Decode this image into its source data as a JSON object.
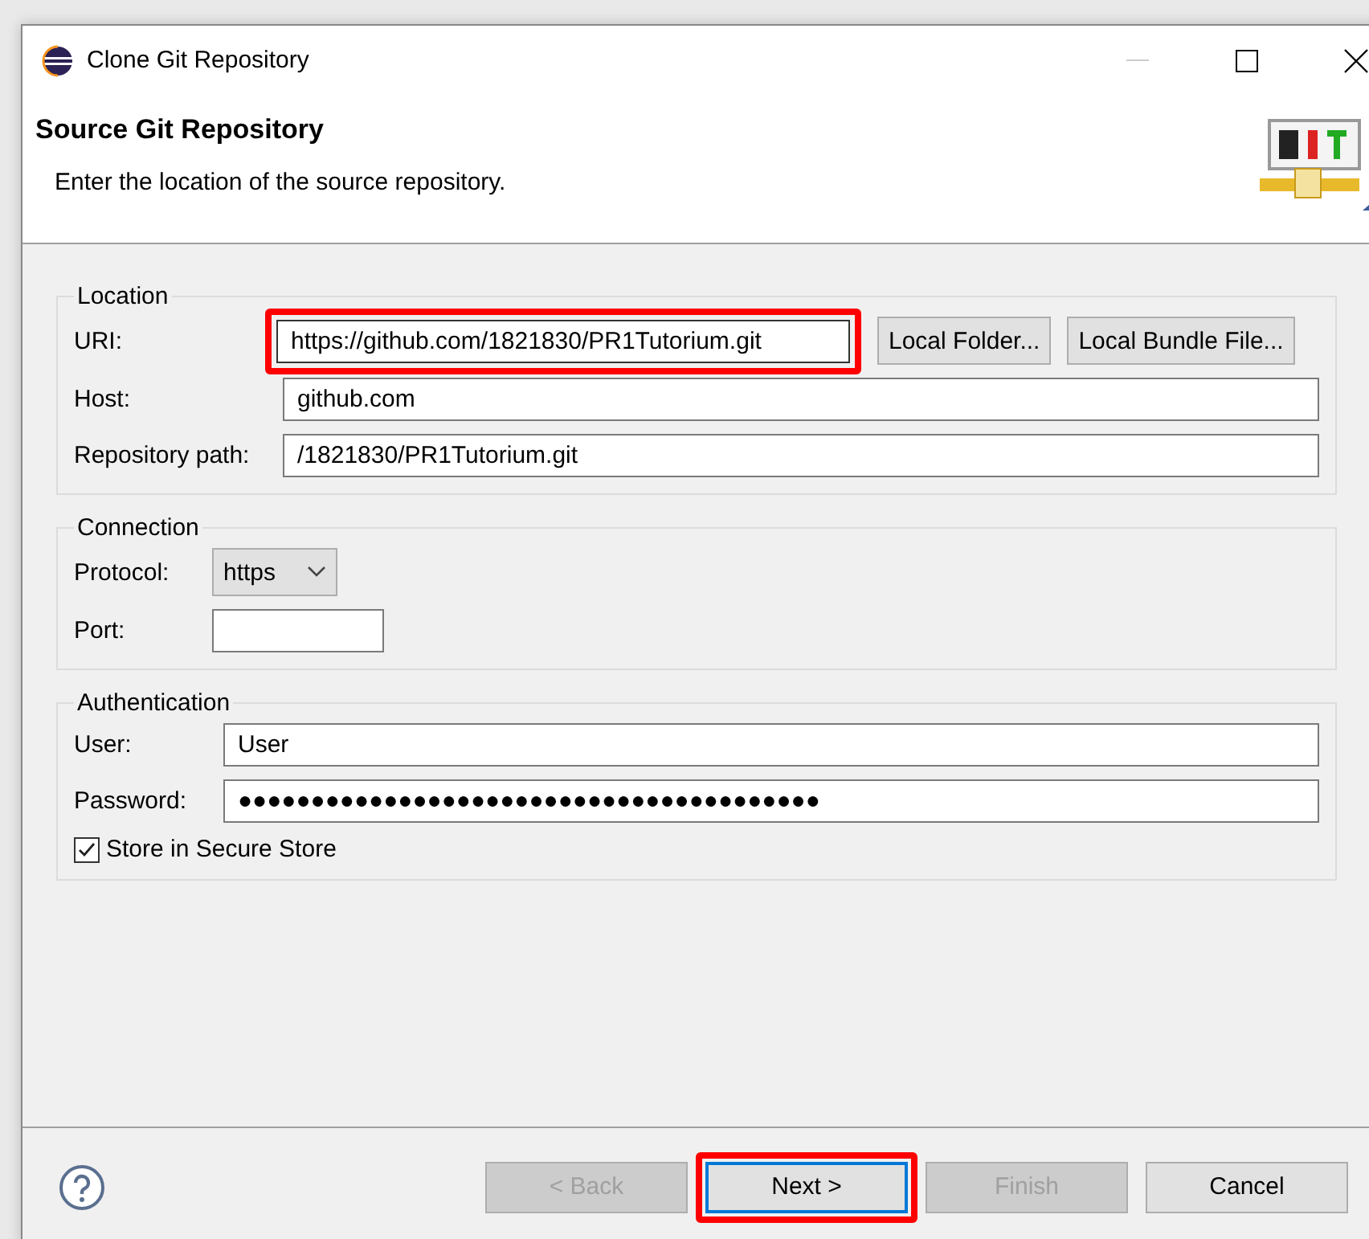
{
  "window": {
    "title": "Clone Git Repository"
  },
  "header": {
    "title": "Source Git Repository",
    "description": "Enter the location of the source repository."
  },
  "groups": [
    {
      "title": "Location",
      "rows": [
        {
          "kind": "uri",
          "label": "URI:",
          "value": "https://github.com/1821830/PR1Tutorium.git",
          "highlighted": true,
          "buttons": [
            "Local Folder...",
            "Local Bundle File..."
          ]
        },
        {
          "kind": "text",
          "label": "Host:",
          "value": "github.com"
        },
        {
          "kind": "text",
          "label": "Repository path:",
          "value": "/1821830/PR1Tutorium.git"
        }
      ]
    },
    {
      "title": "Connection",
      "rows": [
        {
          "kind": "combo",
          "label": "Protocol:",
          "value": "https"
        },
        {
          "kind": "short",
          "label": "Port:",
          "value": ""
        }
      ]
    },
    {
      "title": "Authentication",
      "rows": [
        {
          "kind": "text",
          "label": "User:",
          "value": "User"
        },
        {
          "kind": "text",
          "label": "Password:",
          "value": "●●●●●●●●●●●●●●●●●●●●●●●●●●●●●●●●●●●●●●●●"
        },
        {
          "kind": "checkbox",
          "label": "Store in Secure Store",
          "checked": true
        }
      ]
    }
  ],
  "buttons": [
    {
      "label": "< Back",
      "disabled": true,
      "highlighted": false
    },
    {
      "label": "Next >",
      "disabled": false,
      "highlighted": true
    },
    {
      "label": "Finish",
      "disabled": true,
      "highlighted": false
    },
    {
      "label": "Cancel",
      "disabled": false,
      "highlighted": false
    }
  ]
}
